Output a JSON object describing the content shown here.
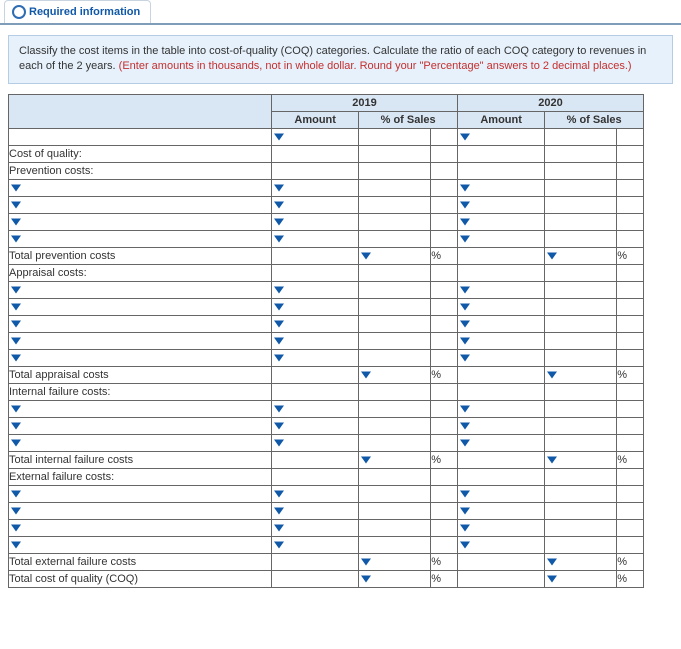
{
  "tab": {
    "label": "Required information"
  },
  "instructions": {
    "main": "Classify the cost items in the table into cost-of-quality (COQ) categories. Calculate the ratio of each COQ category to revenues in each of the 2 years. ",
    "red": "(Enter amounts in thousands, not in whole dollar. Round your \"Percentage\" answers to 2 decimal places.)"
  },
  "years": {
    "y1": "2019",
    "y2": "2020"
  },
  "cols": {
    "amount": "Amount",
    "pct": "% of Sales"
  },
  "unit": {
    "pct": "%"
  },
  "labels": {
    "coq": "Cost of quality:",
    "prev": {
      "h": "Prevention costs:",
      "t": "Total prevention costs"
    },
    "appr": {
      "h": "Appraisal costs:",
      "t": "Total appraisal costs"
    },
    "intf": {
      "h": "Internal failure costs:",
      "t": "Total internal failure costs"
    },
    "extf": {
      "h": "External failure costs:",
      "t": "Total external failure costs"
    },
    "grand": "Total cost of quality (COQ)"
  }
}
